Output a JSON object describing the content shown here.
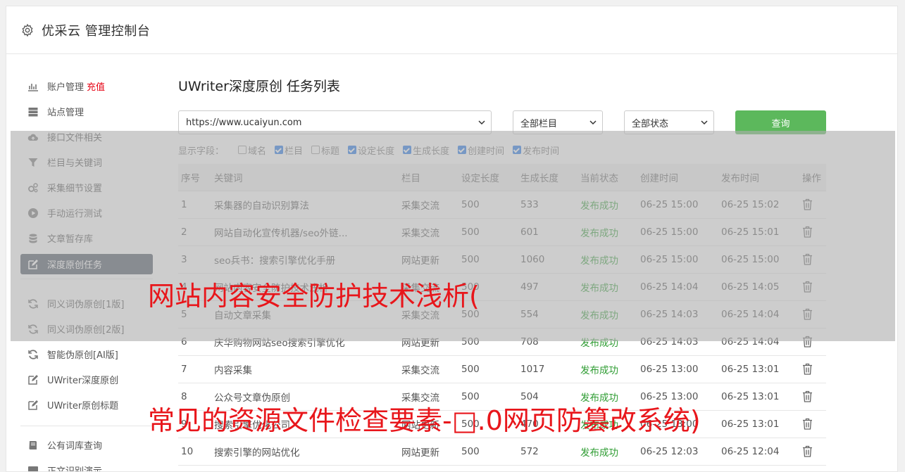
{
  "header": {
    "title": "优采云 管理控制台"
  },
  "sidebar": {
    "items": [
      {
        "label": "账户管理",
        "badge": "充值",
        "icon": "bar-chart-icon"
      },
      {
        "label": "站点管理",
        "icon": "server-icon"
      },
      {
        "label": "接口文件相关",
        "icon": "cloud-upload-icon"
      },
      {
        "label": "栏目与关键词",
        "icon": "filter-icon"
      },
      {
        "label": "采集细节设置",
        "icon": "gears-icon"
      },
      {
        "label": "手动运行测试",
        "icon": "play-circle-icon"
      },
      {
        "label": "文章暂存库",
        "icon": "database-icon"
      },
      {
        "label": "深度原创任务",
        "icon": "edit-icon",
        "active": true
      },
      {
        "label": "同义词伪原创[1版]",
        "icon": "refresh-icon"
      },
      {
        "label": "同义词伪原创[2版]",
        "icon": "refresh-icon"
      },
      {
        "label": "智能伪原创[AI版]",
        "icon": "refresh-icon"
      },
      {
        "label": "UWriter深度原创",
        "icon": "edit-icon"
      },
      {
        "label": "UWriter原创标题",
        "icon": "edit-icon"
      },
      {
        "label": "公有词库查询",
        "icon": "book-icon"
      },
      {
        "label": "正文识别演示",
        "icon": "monitor-icon"
      }
    ]
  },
  "main": {
    "title": "UWriter深度原创 任务列表",
    "site_select": "https://www.ucaiyun.com",
    "column_select": "全部栏目",
    "status_select": "全部状态",
    "query_button": "查询",
    "fields_label": "显示字段：",
    "fields": [
      {
        "label": "域名",
        "checked": false
      },
      {
        "label": "栏目",
        "checked": true
      },
      {
        "label": "标题",
        "checked": false
      },
      {
        "label": "设定长度",
        "checked": true
      },
      {
        "label": "生成长度",
        "checked": true
      },
      {
        "label": "创建时间",
        "checked": true
      },
      {
        "label": "发布时间",
        "checked": true
      }
    ],
    "table": {
      "headers": [
        "序号",
        "关键词",
        "栏目",
        "设定长度",
        "生成长度",
        "当前状态",
        "创建时间",
        "发布时间",
        "操作"
      ],
      "rows": [
        [
          "1",
          "采集器的自动识别算法",
          "采集交流",
          "500",
          "533",
          "发布成功",
          "06-25 15:00",
          "06-25 15:02"
        ],
        [
          "2",
          "网站自动化宣传机器/seo外链...",
          "采集交流",
          "500",
          "601",
          "发布成功",
          "06-25 15:00",
          "06-25 15:01"
        ],
        [
          "3",
          "seo兵书：搜索引擎优化手册",
          "网站更新",
          "500",
          "1060",
          "发布成功",
          "06-25 15:00",
          "06-25 15:00"
        ],
        [
          "4",
          "网站内容安全防护技术浅析",
          "采集交流",
          "500",
          "497",
          "发布成功",
          "06-25 14:04",
          "06-25 14:05"
        ],
        [
          "5",
          "自动文章采集",
          "采集交流",
          "500",
          "554",
          "发布成功",
          "06-25 14:03",
          "06-25 14:04"
        ],
        [
          "6",
          "庆华购物网站seo搜索引擎优化",
          "网站更新",
          "500",
          "708",
          "发布成功",
          "06-25 14:03",
          "06-25 14:04"
        ],
        [
          "7",
          "内容采集",
          "采集交流",
          "500",
          "1017",
          "发布成功",
          "06-25 13:00",
          "06-25 13:01"
        ],
        [
          "8",
          "公众号文章伪原创",
          "采集交流",
          "500",
          "504",
          "发布成功",
          "06-25 13:00",
          "06-25 13:01"
        ],
        [
          "9",
          "搜索引擎优化公司",
          "网站更新",
          "500",
          "470",
          "发布成功",
          "06-25 13:00",
          "06-25 13:01"
        ],
        [
          "10",
          "搜索引擎的网站优化",
          "网站更新",
          "500",
          "572",
          "发布成功",
          "06-25 12:03",
          "06-25 12:04"
        ]
      ]
    }
  },
  "overlay": {
    "line1": "网站内容安全防护技术浅析(",
    "line2": "常见的资源文件检查要素-□.0网页防篡改系统)"
  },
  "colors": {
    "accent_green": "#5cb85c",
    "status_green": "#2e9c32",
    "active_bg": "#4b5461",
    "badge_red": "#e60012",
    "overlay_red": "#e8161b"
  }
}
